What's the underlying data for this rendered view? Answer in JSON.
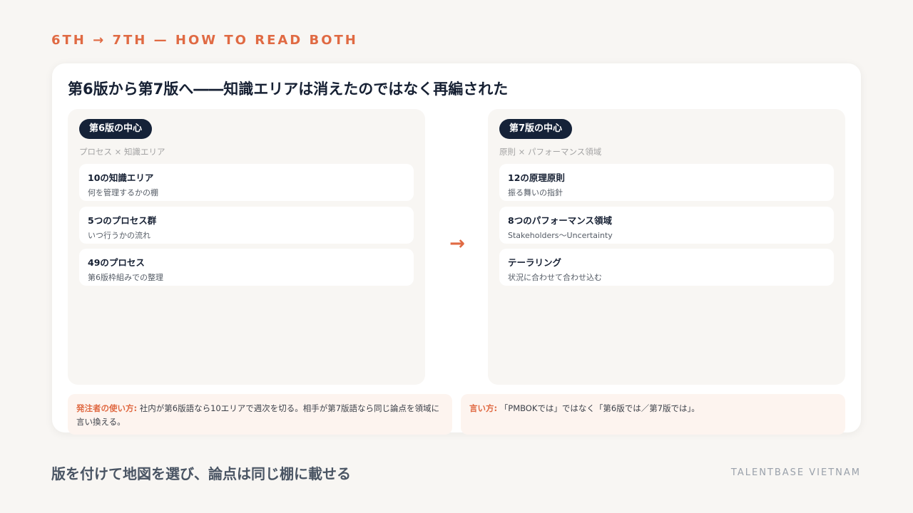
{
  "eyebrow": "6TH → 7TH — HOW TO READ BOTH",
  "title": "第6版から第7版へ――知識エリアは消えたのではなく再編された",
  "left": {
    "badge": "第6版の中心",
    "subtitle": "プロセス × 知識エリア",
    "items": [
      {
        "heading": "10の知識エリア",
        "desc": "何を管理するかの棚"
      },
      {
        "heading": "5つのプロセス群",
        "desc": "いつ行うかの流れ"
      },
      {
        "heading": "49のプロセス",
        "desc": "第6版枠組みでの整理"
      }
    ]
  },
  "arrow": "→",
  "right": {
    "badge": "第7版の中心",
    "subtitle": "原則 × パフォーマンス領域",
    "items": [
      {
        "heading": "12の原理原則",
        "desc": "振る舞いの指針"
      },
      {
        "heading": "8つのパフォーマンス領域",
        "desc": "Stakeholders〜Uncertainty"
      },
      {
        "heading": "テーラリング",
        "desc": "状況に合わせて合わせ込む"
      }
    ]
  },
  "notes": {
    "left_label": "発注者の使い方:",
    "left_text": " 社内が第6版語なら10エリアで週次を切る。相手が第7版語なら同じ論点を領域に言い換える。",
    "right_label": "言い方:",
    "right_text": " 「PMBOKでは」ではなく「第6版では／第7版では」。"
  },
  "footer": {
    "tagline": "版を付けて地図を選び、論点は同じ棚に載せる",
    "brand": "TALENTBASE VIETNAM"
  },
  "colors": {
    "accent": "#e06a43",
    "navy": "#152238",
    "background": "#f8f6f3"
  }
}
